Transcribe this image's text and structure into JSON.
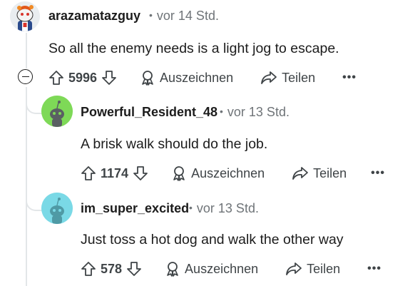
{
  "comments": [
    {
      "username": "arazamatazguy",
      "time": "vor 14 Std.",
      "text": "So all the enemy needs is a light jog to escape.",
      "votes": "5996",
      "award_label": "Auszeichnen",
      "share_label": "Teilen",
      "more": "•••"
    },
    {
      "username": "Powerful_Resident_48",
      "time": "vor 13 Std.",
      "text": "A brisk walk should do the job.",
      "votes": "1174",
      "award_label": "Auszeichnen",
      "share_label": "Teilen",
      "more": "•••",
      "avatar_color": "#7ed957"
    },
    {
      "username": "im_super_excited",
      "time": "vor 13 Std.",
      "text": "Just toss a hot dog and walk the other way",
      "votes": "578",
      "award_label": "Auszeichnen",
      "share_label": "Teilen",
      "more": "•••",
      "avatar_color": "#7ad9e6"
    }
  ],
  "separator": "•",
  "colors": {
    "text": "#1c1c1c",
    "meta": "#6f7478",
    "thread_line": "#e3e6e8"
  },
  "icons": [
    "upvote-icon",
    "downvote-icon",
    "award-icon",
    "share-icon",
    "more-icon",
    "collapse-icon"
  ]
}
